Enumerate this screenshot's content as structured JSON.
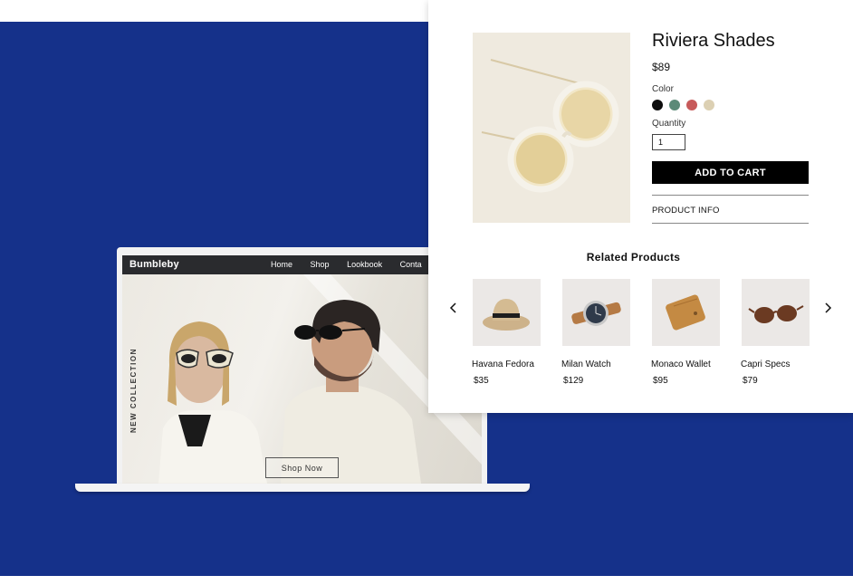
{
  "site": {
    "logo": "Bumbleby",
    "nav": [
      "Home",
      "Shop",
      "Lookbook",
      "Conta"
    ],
    "hero_vertical_text": "NEW COLLECTION",
    "hero_button": "Shop Now"
  },
  "product": {
    "title": "Riviera Shades",
    "price": "$89",
    "color_label": "Color",
    "colors": [
      "#0d0d0d",
      "#5c8a78",
      "#c75a5a",
      "#dcd0b3"
    ],
    "quantity_label": "Quantity",
    "quantity_value": "1",
    "add_to_cart": "ADD TO CART",
    "product_info": "PRODUCT INFO"
  },
  "related": {
    "title": "Related Products",
    "items": [
      {
        "name": "Havana Fedora",
        "price": "$35",
        "icon": "fedora-hat-icon"
      },
      {
        "name": "Milan Watch",
        "price": "$129",
        "icon": "wristwatch-icon"
      },
      {
        "name": "Monaco Wallet",
        "price": "$95",
        "icon": "wallet-icon"
      },
      {
        "name": "Capri Specs",
        "price": "$79",
        "icon": "sunglasses-icon"
      }
    ]
  },
  "colors": {
    "background_blue": "#15318a",
    "nav_dark": "#2a2b2e",
    "button_black": "#000000"
  }
}
